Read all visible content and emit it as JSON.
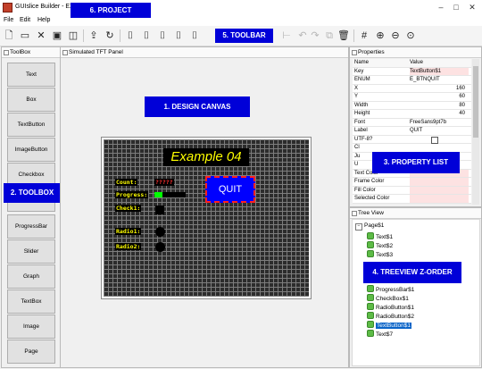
{
  "window": {
    "title": "GUIslice Builder - EX_04.prj",
    "minimize": "–",
    "maximize": "□",
    "close": "✕"
  },
  "menu": [
    "File",
    "Edit",
    "Help"
  ],
  "toolbar": {
    "icons": [
      "new-file",
      "open-folder",
      "close",
      "save",
      "save-as",
      "print",
      "undo-arrow",
      "redo-arrow",
      "align-left",
      "align-top",
      "align-bottom",
      "align-right",
      "align-center",
      "cut",
      "copy",
      "paste",
      "delete",
      "grid",
      "zoom-in",
      "zoom-out",
      "zoom-reset"
    ]
  },
  "panels": {
    "toolbox_title": "ToolBox",
    "sim_title": "Simulated TFT Panel",
    "props_title": "Properties",
    "tree_title": "Tree View"
  },
  "toolbox_items": [
    "Text",
    "Box",
    "TextButton",
    "ImageButton",
    "Checkbox",
    "Radio",
    "ProgressBar",
    "Slider",
    "Graph",
    "TextBox",
    "Image",
    "Page"
  ],
  "canvas": {
    "title": "Example 04",
    "labels": [
      "Count:",
      "Progress:",
      "Check1:",
      "Radio1:",
      "Radio2:"
    ],
    "count_value": "?????",
    "button_label": "QUIT"
  },
  "properties": {
    "headers": [
      "Name",
      "Value"
    ],
    "rows": [
      {
        "key": "Key",
        "value": "TextButton$1"
      },
      {
        "key": "ENUM",
        "value": "E_BTNQUIT"
      },
      {
        "key": "X",
        "value": "160"
      },
      {
        "key": "Y",
        "value": "60"
      },
      {
        "key": "Width",
        "value": "80"
      },
      {
        "key": "Height",
        "value": "40"
      },
      {
        "key": "Font",
        "value": "FreeSans9pt7b"
      },
      {
        "key": "Label",
        "value": "QUIT"
      },
      {
        "key": "UTF-8?",
        "value": ""
      },
      {
        "key": "Cl",
        "value": ""
      },
      {
        "key": "Ju",
        "value": ""
      },
      {
        "key": "U",
        "value": ""
      },
      {
        "key": "Text Color",
        "value": ""
      },
      {
        "key": "Frame Color",
        "value": ""
      },
      {
        "key": "Fill Color",
        "value": ""
      },
      {
        "key": "Selected Color",
        "value": ""
      }
    ]
  },
  "tree": {
    "items": [
      "Page$1",
      "Text$1",
      "Text$2",
      "Text$3",
      "ProgressBar$1",
      "CheckBox$1",
      "RadioButton$1",
      "RadioButton$2",
      "TextButton$1",
      "Text$7"
    ],
    "selected": "TextButton$1"
  },
  "annotations": {
    "project": "6. PROJECT",
    "toolbar": "5. TOOLBAR",
    "design_canvas": "1. DESIGN CANVAS",
    "toolbox": "2. TOOLBOX",
    "property_list": "3. PROPERTY LIST",
    "treeview": "4. TREEVIEW Z-ORDER"
  },
  "colors": {
    "callout": "#0000d8",
    "canvas_text": "#ffff00",
    "button_fill": "#0000ff",
    "selection": "#0a64c8",
    "progress_fill": "#00ff00"
  }
}
